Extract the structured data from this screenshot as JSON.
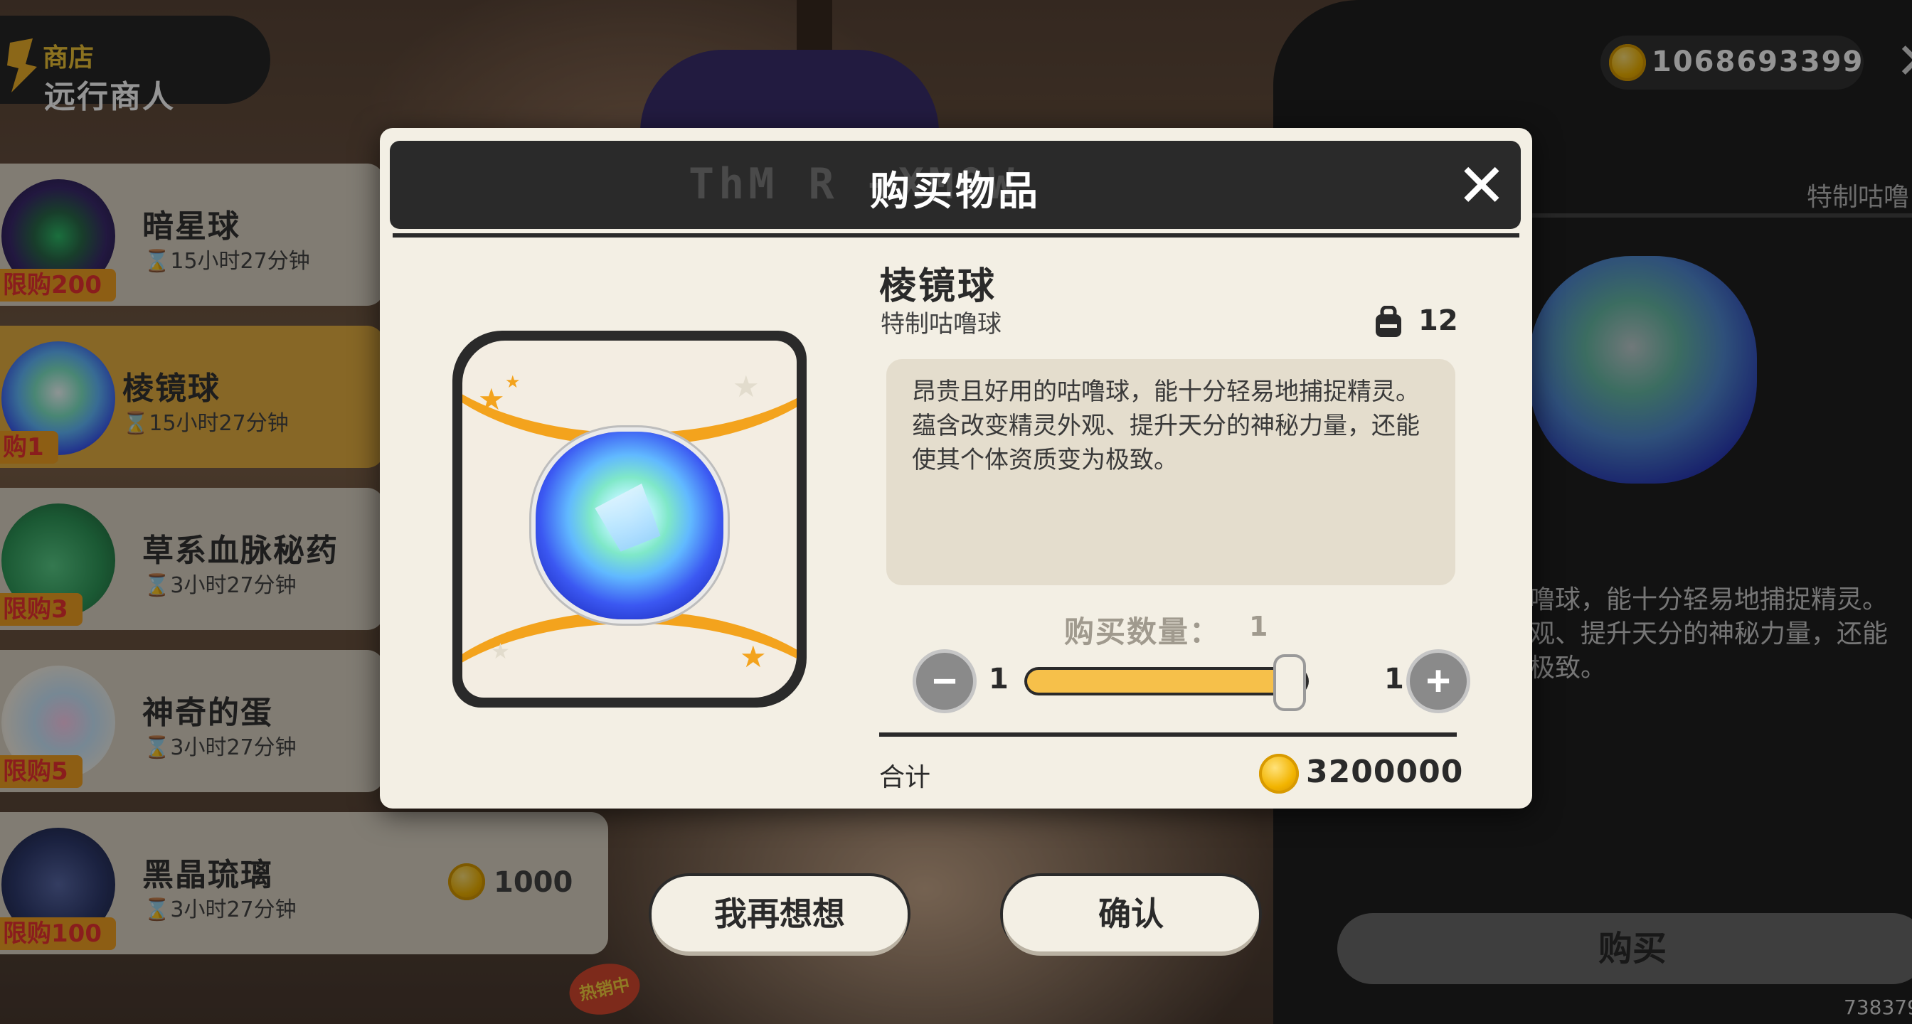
{
  "header": {
    "section_label": "商店",
    "title": "远行商人"
  },
  "currency": {
    "icon": "gold-coin-icon",
    "value": "1068693399"
  },
  "shop_items": [
    {
      "name": "暗星球",
      "timer": "⌛15小时27分钟",
      "limit": "限购200",
      "rarity_color": "#7a3fd0"
    },
    {
      "name": "棱镜球",
      "timer": "⌛15小时27分钟",
      "limit": "购1",
      "rarity_color": "#f3a223"
    },
    {
      "name": "草系血脉秘药",
      "timer": "⌛3小时27分钟",
      "limit": "限购3",
      "rarity_color": "#7a3fd0"
    },
    {
      "name": "神奇的蛋",
      "timer": "⌛3小时27分钟",
      "limit": "限购5",
      "rarity_color": "#7a3fd0"
    },
    {
      "name": "黑晶琉璃",
      "timer": "⌛3小时27分钟",
      "limit": "限购100",
      "price": "1000",
      "rarity_color": "#44aa44"
    }
  ],
  "bottom_badge": "热销中",
  "detail_panel": {
    "subtitle": "特制咕噜",
    "description": "噜球，能十分轻易地捕捉精灵。\n观、提升天分的神秘力量，还能\n极致。",
    "buy_label": "购买",
    "id_text": "738379"
  },
  "dialog": {
    "title_deco": "ThM R    +XMOW",
    "title": "购买物品",
    "item_title": "棱镜球",
    "item_subtitle": "特制咕噜球",
    "owned_count": "12",
    "description": "昂贵且好用的咕噜球，能十分轻易地捕捉精灵。\n蕴含改变精灵外观、提升天分的神秘力量，还能使其个体资质变为极致。",
    "quantity_label": "购买数量：",
    "quantity_value": "1",
    "slider_min_label": "1",
    "slider_max_label": "1",
    "slider_fraction": 1.0,
    "total_label": "合计",
    "total_value": "3200000",
    "minus_symbol": "−",
    "plus_symbol": "+",
    "close_symbol": "✕"
  },
  "buttons": {
    "cancel": "我再想想",
    "confirm": "确认"
  },
  "colors": {
    "accent": "#f3a31d",
    "slider_fill": "#f6c04a",
    "dialog_bg": "#f3efe4",
    "dark": "#2a2a2a"
  }
}
